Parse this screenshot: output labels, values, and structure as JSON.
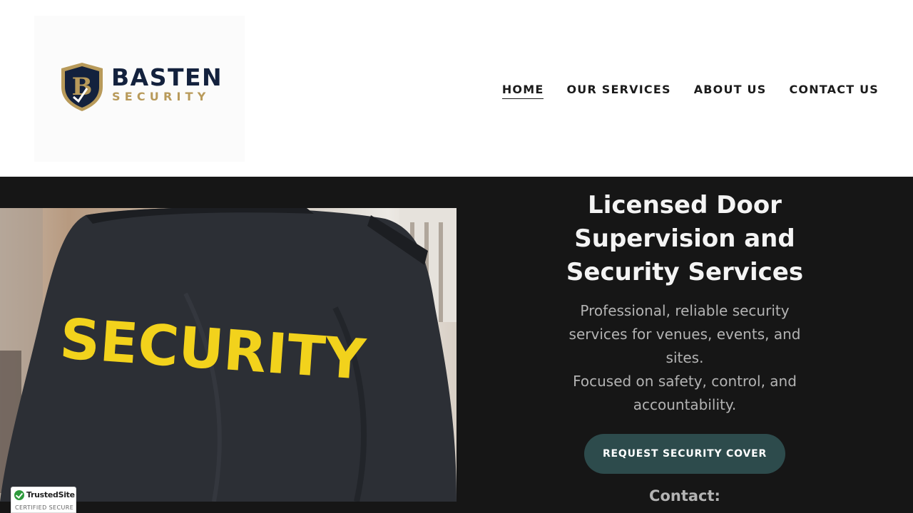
{
  "brand": {
    "name": "BASTEN",
    "tagline": "SECURITY",
    "colors": {
      "navy": "#13213d",
      "gold": "#b89a5a"
    }
  },
  "nav": {
    "items": [
      {
        "label": "HOME",
        "active": true
      },
      {
        "label": "OUR SERVICES",
        "active": false
      },
      {
        "label": "ABOUT US",
        "active": false
      },
      {
        "label": "CONTACT US",
        "active": false
      }
    ]
  },
  "hero": {
    "photo_text": "SECURITY",
    "title": "Licensed Door Supervision and Security Services",
    "description": [
      "Professional, reliable security services for venues, events, and sites.",
      "Focused on safety, control, and accountability."
    ],
    "cta_label": "REQUEST SECURITY COVER",
    "contact_label": "Contact:",
    "colors": {
      "background": "#161616",
      "cta": "#2d4b4c"
    }
  },
  "badge": {
    "name": "TrustedSite",
    "subtitle": "CERTIFIED SECURE"
  }
}
